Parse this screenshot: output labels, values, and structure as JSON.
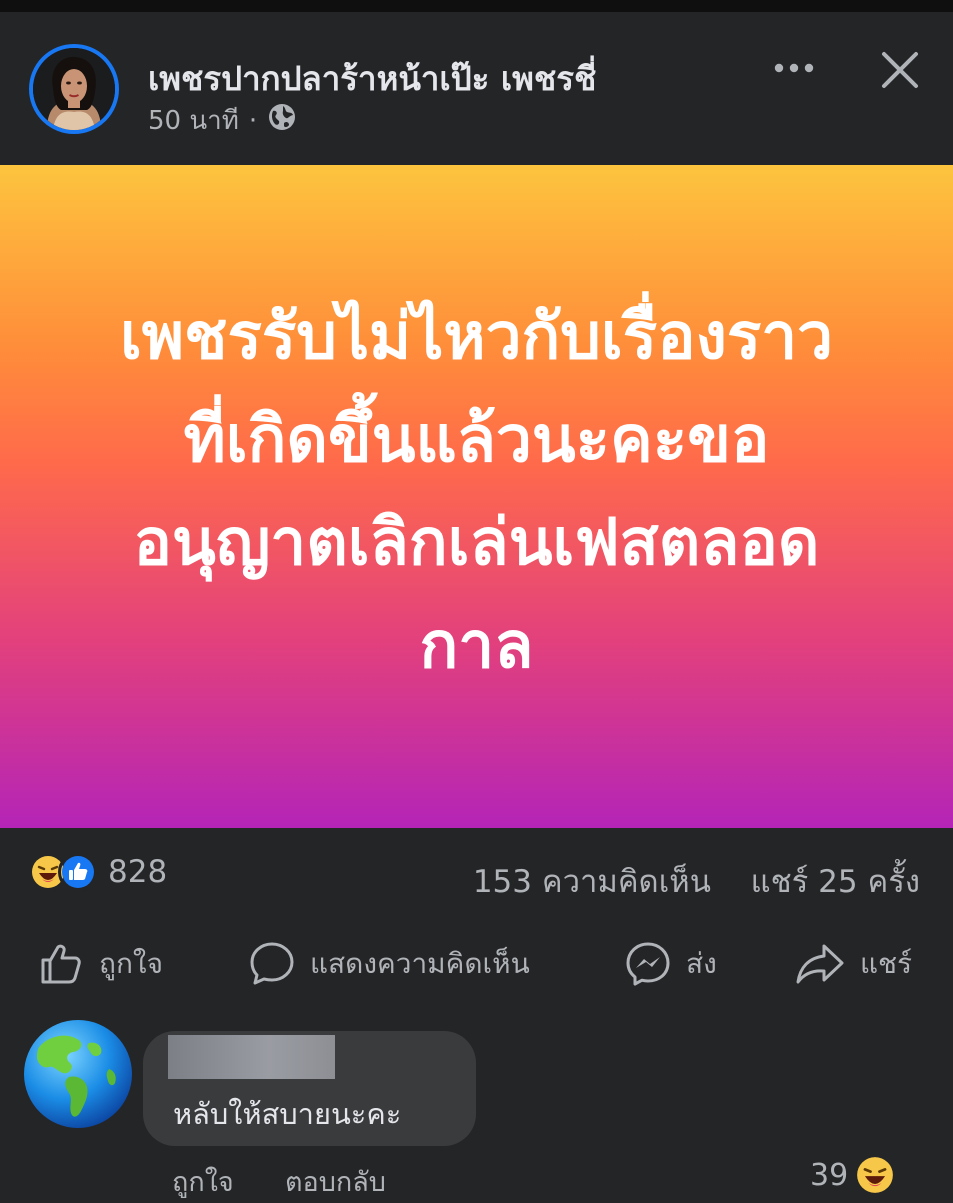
{
  "post": {
    "author": "เพชรปากปลาร้าหน้าเป๊ะ เพชรชี่",
    "time": "50 นาที",
    "separator": "·",
    "privacy_icon": "globe-icon",
    "banner_text": "เพชรรับไม่ไหวกับเรื่องราวที่เกิดขึ้นแล้วนะคะขออนุญาตเลิกเล่นเฟสตลอดกาล",
    "banner_lines": [
      "เพชรรับไม่ไหวกับเรื่องราว",
      "ที่เกิดขึ้นแล้วนะคะขอ",
      "อนุญาตเลิกเล่นเฟสตลอด",
      "กาล"
    ],
    "banner_colors": [
      "#fdc43e",
      "#ff6a4b",
      "#b424b7"
    ]
  },
  "reactions": {
    "icons": [
      "laugh-reaction-icon",
      "like-reaction-icon"
    ],
    "count": "828",
    "comments": "153 ความคิดเห็น",
    "shares": "แชร์ 25 ครั้ง"
  },
  "actions": {
    "like": "ถูกใจ",
    "comment": "แสดงความคิดเห็น",
    "send": "ส่ง",
    "share": "แชร์"
  },
  "comment": {
    "author_redacted": true,
    "text": "หลับให้สบายนะคะ",
    "like": "ถูกใจ",
    "reply": "ตอบกลับ",
    "reaction_count": "39"
  },
  "colors": {
    "background": "#242526",
    "accent": "#1877f2",
    "muted_text": "#b0b3b8"
  }
}
